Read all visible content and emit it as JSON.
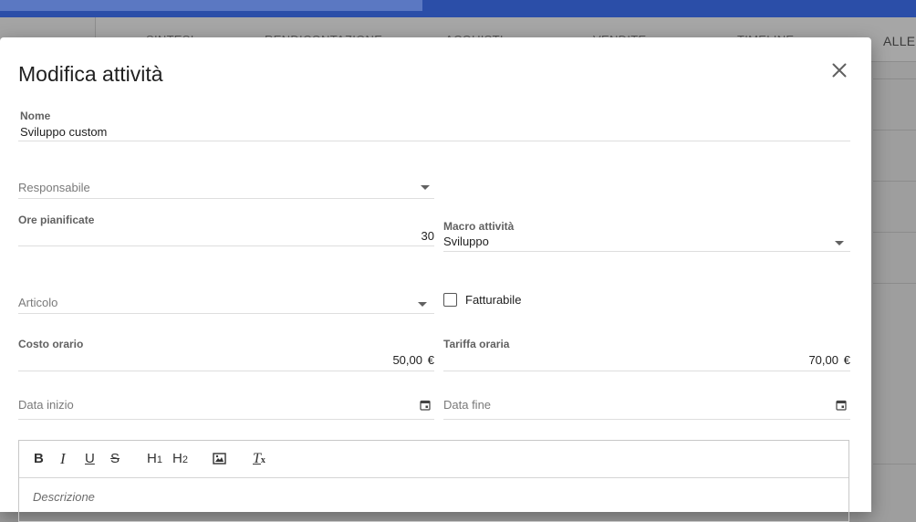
{
  "background": {
    "tabs": [
      "SINTESI",
      "RENDICONTAZIONE",
      "ACQUISTI",
      "VENDITE",
      "TIMELINE",
      "ALLEG"
    ]
  },
  "dialog": {
    "title": "Modifica attività",
    "close_icon": "close-icon",
    "fields": {
      "nome": {
        "label": "Nome",
        "value": "Sviluppo custom"
      },
      "responsabile": {
        "placeholder": "Responsabile"
      },
      "ore_pianificate": {
        "label": "Ore pianificate",
        "value": "30"
      },
      "macro_attivita": {
        "label": "Macro attività",
        "value": "Sviluppo"
      },
      "articolo": {
        "placeholder": "Articolo"
      },
      "fatturabile": {
        "label": "Fatturabile",
        "checked": false
      },
      "costo_orario": {
        "label": "Costo orario",
        "value": "50,00",
        "unit": "€"
      },
      "tariffa_oraria": {
        "label": "Tariffa oraria",
        "value": "70,00",
        "unit": "€"
      },
      "data_inizio": {
        "placeholder": "Data inizio"
      },
      "data_fine": {
        "placeholder": "Data fine"
      }
    },
    "editor": {
      "toolbar": [
        "bold",
        "italic",
        "underline",
        "strikethrough",
        "header-1",
        "header-2",
        "image",
        "clear-format"
      ],
      "bold_label": "B",
      "italic_label": "I",
      "underline_label": "U",
      "strike_label": "S",
      "h1_label": "H",
      "h1_sub": "1",
      "h2_label": "H",
      "h2_sub": "2",
      "clear_label": "T",
      "clear_sub": "x",
      "placeholder": "Descrizione"
    }
  }
}
